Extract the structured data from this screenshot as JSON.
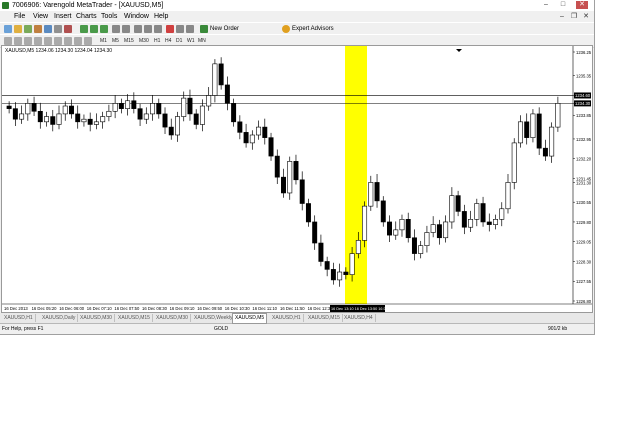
{
  "window": {
    "title": "7006906: Varengold MetaTrader - [XAUUSD,M5]"
  },
  "menu": [
    "File",
    "View",
    "Insert",
    "Charts",
    "Tools",
    "Window",
    "Help"
  ],
  "toolbar": {
    "new_order": "New Order",
    "expert_advisors": "Expert Advisors",
    "timeframes": [
      "M1",
      "M5",
      "M15",
      "M30",
      "H1",
      "H4",
      "D1",
      "W1",
      "MN"
    ]
  },
  "chart": {
    "caption": "XAUUSD,M5  1234.06 1234.30 1234.04 1234.30",
    "price_labels": [
      "1236.25",
      "1235.35",
      "1234.60",
      "1234.30",
      "1233.85",
      "1232.95",
      "1232.20",
      "1231.45",
      "1231.30",
      "1230.55",
      "1229.80",
      "1229.05",
      "1228.30",
      "1227.55",
      "1226.80"
    ],
    "current_price": "1234.30",
    "line_price_upper": "1234.60",
    "line_price_lower": "1234.30",
    "time_labels": [
      "16 Dec 2013",
      "16 Dec 05:20",
      "16 Dec 06:00",
      "16 Dec 07:10",
      "16 Dec 07:50",
      "16 Dec 08:30",
      "16 Dec 09:10",
      "16 Dec 09:50",
      "16 Dec 10:30",
      "16 Dec 11:10",
      "16 Dec 11:50",
      "16 Dec 12:30"
    ],
    "highlight_label": "16 Dec 13:10  16 Dec 13:50  16 Dec 14:30",
    "highlight_color": "#ffff00",
    "highlight_green_label": "",
    "candle_color": "#000000"
  },
  "chart_data": {
    "type": "candlestick",
    "ylim": [
      1226.8,
      1236.25
    ],
    "close": [
      1234.1,
      1233.7,
      1233.9,
      1234.3,
      1234.0,
      1233.6,
      1233.8,
      1233.5,
      1233.9,
      1234.2,
      1233.9,
      1233.6,
      1233.7,
      1233.5,
      1233.6,
      1233.8,
      1234.0,
      1234.3,
      1234.1,
      1234.4,
      1234.1,
      1233.7,
      1233.9,
      1234.3,
      1233.9,
      1233.4,
      1233.1,
      1233.8,
      1234.5,
      1233.9,
      1233.5,
      1234.2,
      1234.6,
      1235.8,
      1235.0,
      1234.3,
      1233.6,
      1233.2,
      1232.8,
      1233.1,
      1233.4,
      1233.0,
      1232.3,
      1231.5,
      1230.9,
      1232.1,
      1231.4,
      1230.5,
      1229.8,
      1229.0,
      1228.3,
      1228.0,
      1227.6,
      1227.9,
      1227.8,
      1228.6,
      1229.1,
      1230.4,
      1231.3,
      1230.6,
      1229.8,
      1229.3,
      1229.5,
      1229.9,
      1229.2,
      1228.6,
      1228.9,
      1229.4,
      1229.7,
      1229.2,
      1229.8,
      1230.8,
      1230.2,
      1229.6,
      1229.9,
      1230.5,
      1229.8,
      1229.7,
      1229.9,
      1230.3,
      1231.3,
      1232.8,
      1233.6,
      1233.0,
      1233.9,
      1232.6,
      1232.3,
      1233.4,
      1234.3
    ]
  }
}
